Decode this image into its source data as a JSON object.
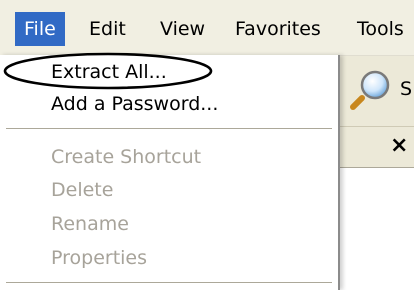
{
  "menubar": {
    "items": [
      {
        "label": "File",
        "active": true
      },
      {
        "label": "Edit",
        "active": false
      },
      {
        "label": "View",
        "active": false
      },
      {
        "label": "Favorites",
        "active": false
      },
      {
        "label": "Tools",
        "active": false
      }
    ]
  },
  "file_menu": {
    "group1": [
      {
        "label": "Extract All...",
        "enabled": true,
        "circled": true
      },
      {
        "label": "Add a Password...",
        "enabled": true
      }
    ],
    "group2": [
      {
        "label": "Create Shortcut",
        "enabled": false
      },
      {
        "label": "Delete",
        "enabled": false
      },
      {
        "label": "Rename",
        "enabled": false
      },
      {
        "label": "Properties",
        "enabled": false
      }
    ]
  },
  "toolbar": {
    "search_label": "S",
    "search_icon": "magnifier-icon"
  },
  "pane": {
    "close_glyph": "×"
  },
  "colors": {
    "menubar_bg": "#f1efe2",
    "active_menu_bg": "#316ac5",
    "disabled_text": "#a7a39a",
    "annotation_ellipse": "#000000"
  }
}
